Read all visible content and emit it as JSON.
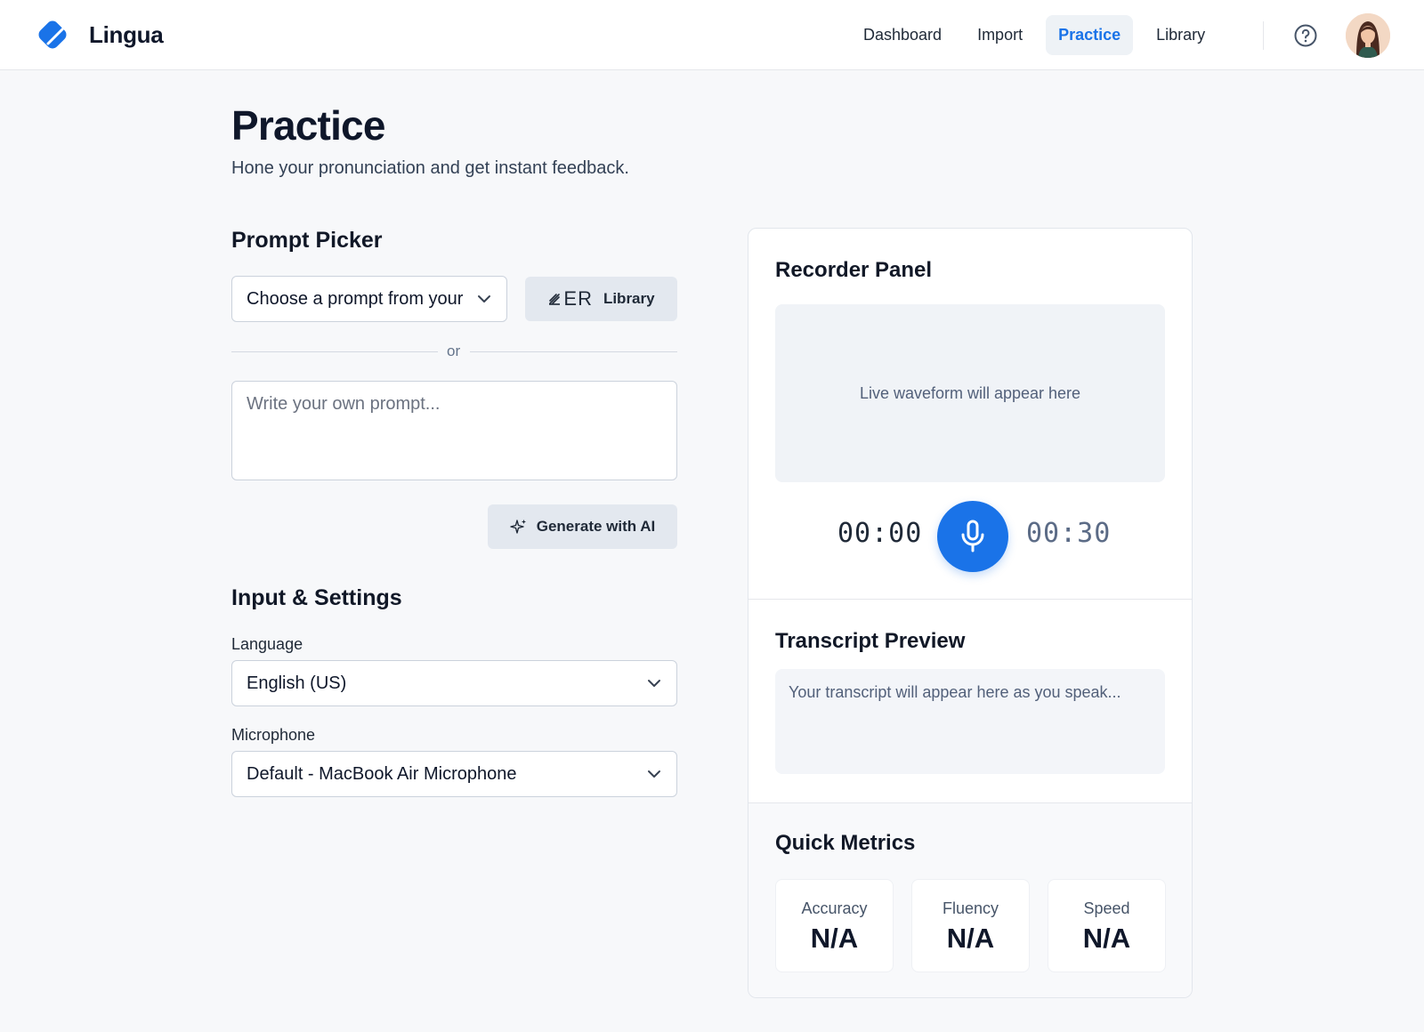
{
  "app": {
    "name": "Lingua",
    "accent_color": "#1a73e8"
  },
  "nav": {
    "items": [
      {
        "label": "Dashboard",
        "active": false
      },
      {
        "label": "Import",
        "active": false
      },
      {
        "label": "Practice",
        "active": true
      },
      {
        "label": "Library",
        "active": false
      }
    ],
    "help_icon": "question-circle-icon",
    "avatar_icon": "user-avatar"
  },
  "page": {
    "title": "Practice",
    "subtitle": "Hone your pronunciation and get instant feedback."
  },
  "prompt_picker": {
    "title": "Prompt Picker",
    "select_text": "Choose a prompt from your library",
    "library_button": "Library",
    "library_icon_text": "ER",
    "or_text": "or",
    "textarea_placeholder": "Write your own prompt...",
    "generate_button": "Generate with AI"
  },
  "settings": {
    "title": "Input & Settings",
    "language_label": "Language",
    "language_value": "English (US)",
    "microphone_label": "Microphone",
    "microphone_value": "Default - MacBook Air Microphone"
  },
  "recorder": {
    "title": "Recorder Panel",
    "waveform_placeholder": "Live waveform will appear here",
    "elapsed": "00:00",
    "limit": "00:30"
  },
  "transcript": {
    "title": "Transcript Preview",
    "placeholder": "Your transcript will appear here as you speak..."
  },
  "metrics": {
    "title": "Quick Metrics",
    "items": [
      {
        "label": "Accuracy",
        "value": "N/A"
      },
      {
        "label": "Fluency",
        "value": "N/A"
      },
      {
        "label": "Speed",
        "value": "N/A"
      }
    ]
  }
}
